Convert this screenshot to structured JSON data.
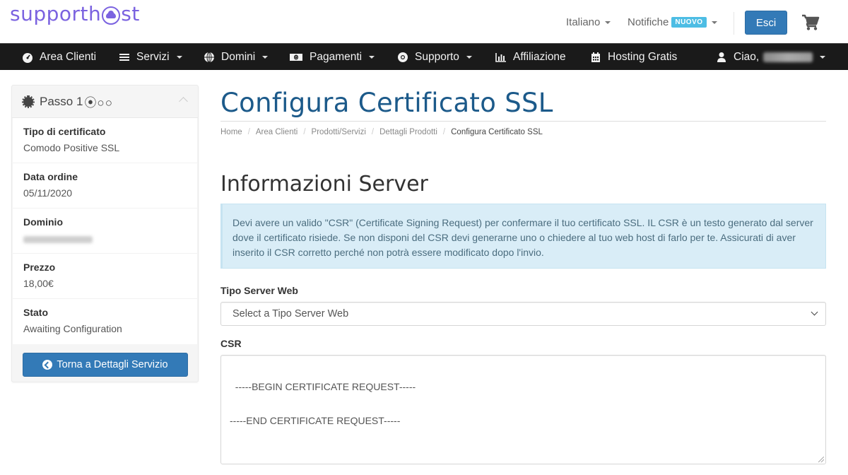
{
  "header": {
    "logo_text_before": "supporth",
    "logo_text_after": "st",
    "brand_color": "#7b63e0",
    "language": "Italiano",
    "notifications": "Notifiche",
    "notifications_badge": "NUOVO",
    "logout": "Esci",
    "cart_icon": "shopping-cart-icon"
  },
  "nav": {
    "items": [
      {
        "label": "Area Clienti",
        "icon": "dashboard-icon",
        "dropdown": false
      },
      {
        "label": "Servizi",
        "icon": "list-icon",
        "dropdown": true
      },
      {
        "label": "Domini",
        "icon": "globe-icon",
        "dropdown": true
      },
      {
        "label": "Pagamenti",
        "icon": "money-icon",
        "dropdown": true
      },
      {
        "label": "Supporto",
        "icon": "life-ring-icon",
        "dropdown": true
      },
      {
        "label": "Affiliazione",
        "icon": "bar-chart-icon",
        "dropdown": false
      },
      {
        "label": "Hosting Gratis",
        "icon": "calendar-icon",
        "dropdown": false
      },
      {
        "label": "Ciao,",
        "icon": "user-icon",
        "dropdown": true
      }
    ]
  },
  "sidebar": {
    "step_label": "Passo 1",
    "step_indicators": "⦿○○",
    "rows": [
      {
        "label": "Tipo di certificato",
        "value": "Comodo Positive SSL"
      },
      {
        "label": "Data ordine",
        "value": "05/11/2020"
      },
      {
        "label": "Dominio",
        "value": ""
      },
      {
        "label": "Prezzo",
        "value": "18,00€"
      },
      {
        "label": "Stato",
        "value": "Awaiting Configuration"
      }
    ],
    "back_button": "Torna a Dettagli Servizio"
  },
  "main": {
    "title": "Configura Certificato SSL",
    "breadcrumb": [
      "Home",
      "Area Clienti",
      "Prodotti/Servizi",
      "Dettagli Prodotti",
      "Configura Certificato SSL"
    ],
    "section_title": "Informazioni Server",
    "alert_text": "Devi avere un valido \"CSR\" (Certificate Signing Request) per confermare il tuo certificato SSL. IL CSR è un testo generato dal server dove il certificato risiede. Se non disponi del CSR devi generarne uno o chiedere al tuo web host di farlo per te. Assicurati di aver inserito il CSR corretto perché non potrà essere modificato dopo l'invio.",
    "server_type_label": "Tipo Server Web",
    "server_type_value": "Select a Tipo Server Web",
    "csr_label": "CSR",
    "csr_value": "-----BEGIN CERTIFICATE REQUEST-----\n\n-----END CERTIFICATE REQUEST-----"
  },
  "colors": {
    "primary": "#337ab7",
    "title": "#1c5a8a",
    "navbar": "#1a1a1a",
    "alert_bg": "#d9edf7",
    "badge": "#4dbde4"
  }
}
